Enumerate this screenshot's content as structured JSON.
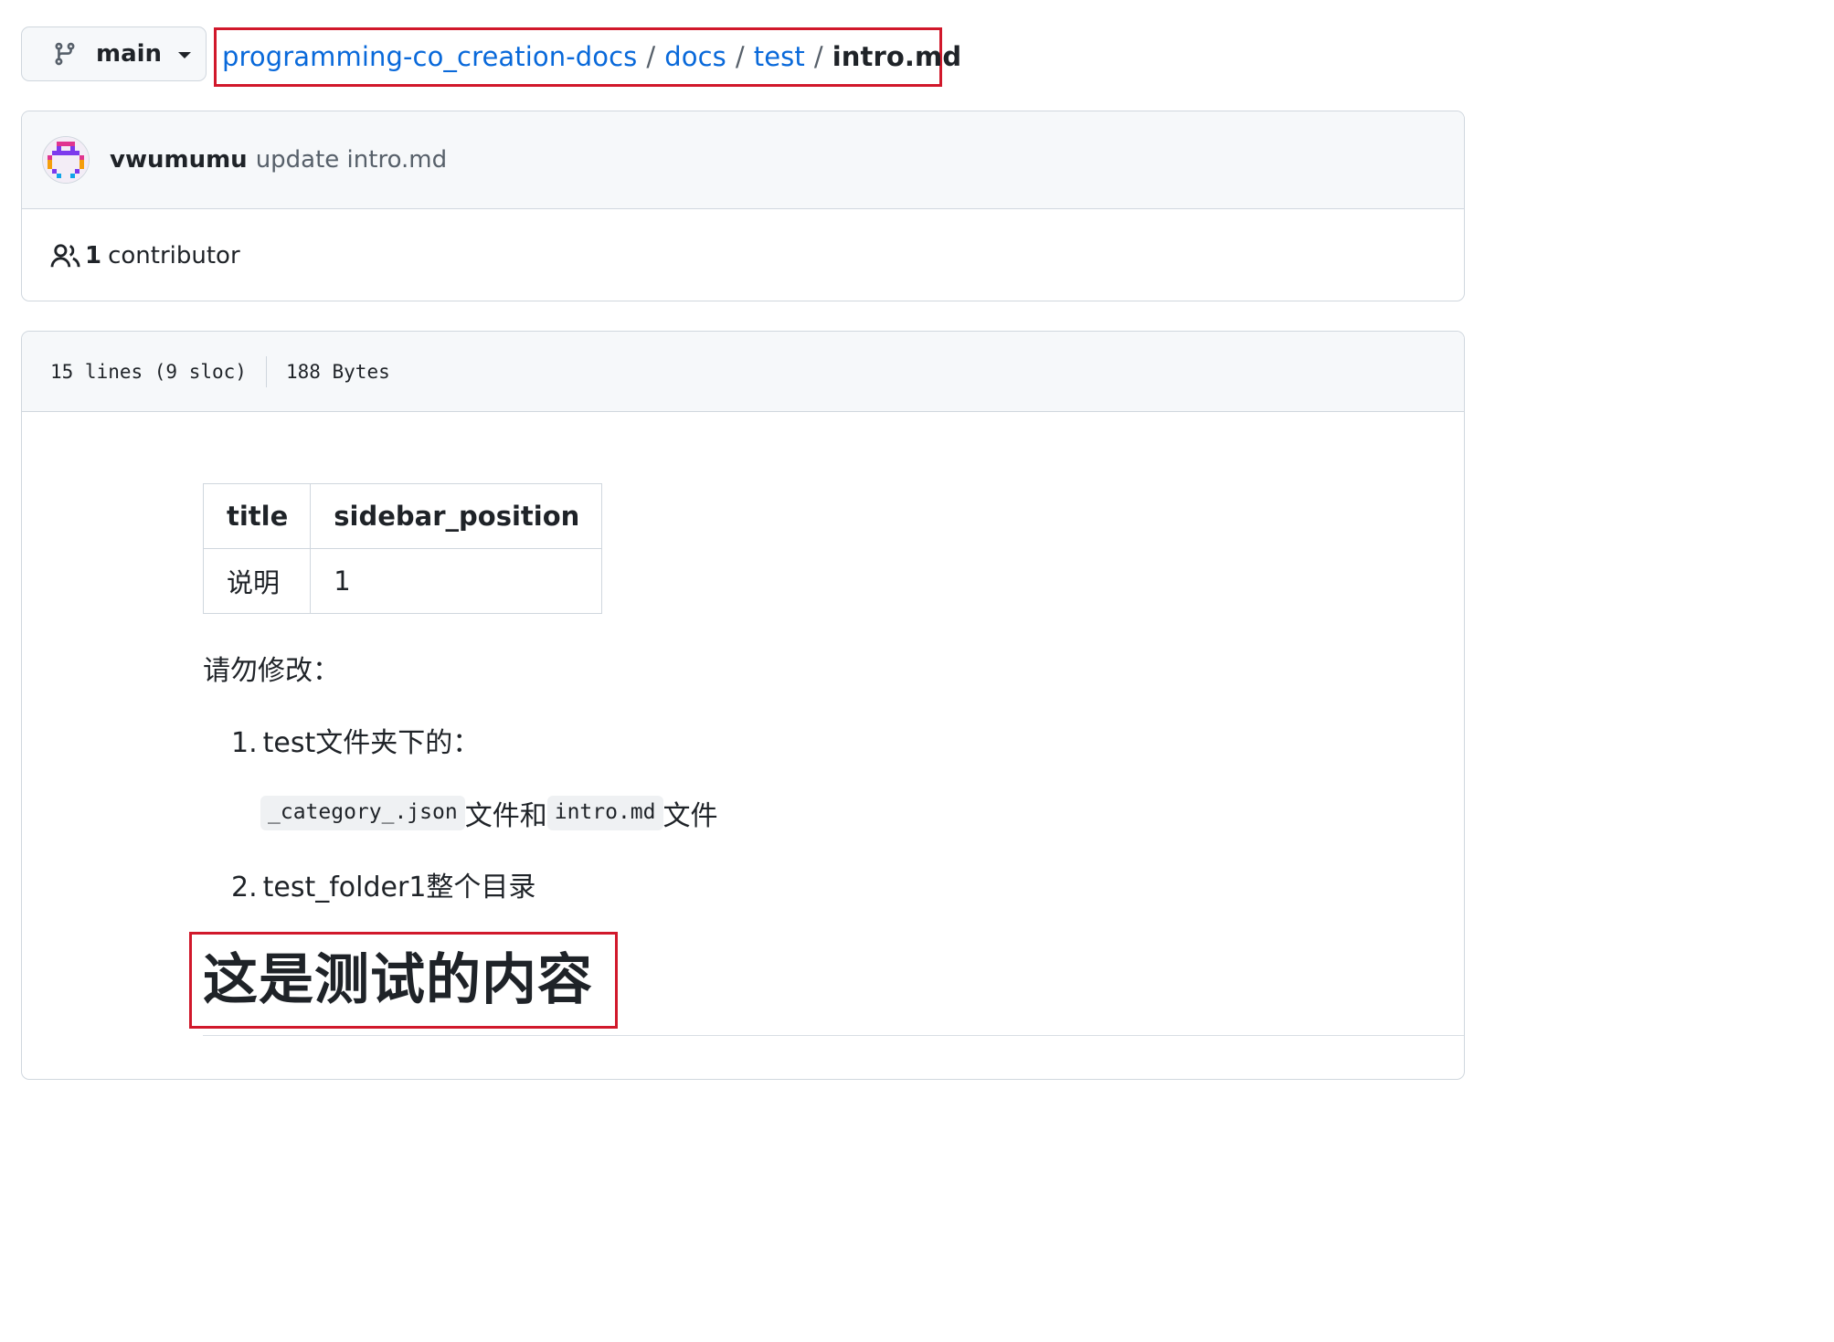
{
  "branch": {
    "name": "main"
  },
  "breadcrumb": {
    "repo": "programming-co_creation-docs",
    "folder1": "docs",
    "folder2": "test",
    "file": "intro.md",
    "separator": "/"
  },
  "commit": {
    "author": "vwumumu",
    "message": "update intro.md"
  },
  "contributors": {
    "count": "1",
    "label": "contributor"
  },
  "file_info": {
    "lines": "15 lines (9 sloc)",
    "size": "188 Bytes"
  },
  "markdown": {
    "table": {
      "headers": [
        "title",
        "sidebar_position"
      ],
      "rows": [
        [
          "说明",
          "1"
        ]
      ]
    },
    "intro": "请勿修改：",
    "list": [
      {
        "num": "1.",
        "text": "test文件夹下的："
      },
      {
        "num": "2.",
        "text": "test_folder1整个目录"
      }
    ],
    "sub": {
      "code1": "_category_.json",
      "text1": "文件和",
      "code2": "intro.md",
      "text2": "文件"
    },
    "heading": "这是测试的内容"
  },
  "colors": {
    "link": "#0969da",
    "highlight_border": "#d1182b",
    "text": "#1f2328",
    "muted": "#57606a"
  },
  "icons": {
    "branch": "git-branch-icon",
    "caret": "caret-down-icon",
    "people": "people-icon"
  }
}
